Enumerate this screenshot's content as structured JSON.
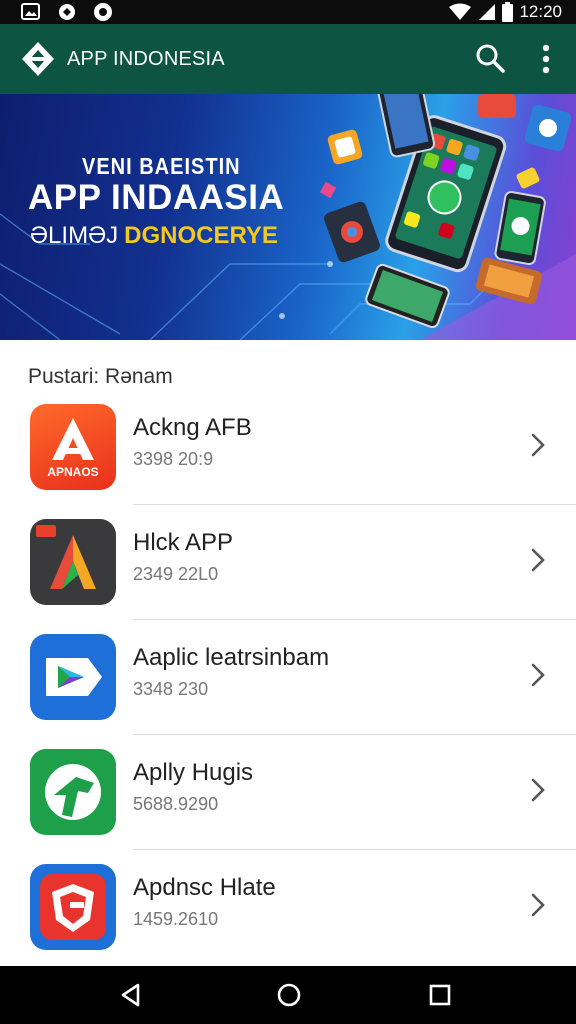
{
  "status_bar": {
    "time": "12:20",
    "icons": [
      "image-notification-icon",
      "app-notification-icon",
      "sync-notification-icon",
      "wifi-icon",
      "signal-icon",
      "battery-icon"
    ]
  },
  "app_bar": {
    "title": "APP INDONESIA",
    "logo_icon": "diamond-logo-icon",
    "actions": [
      "search-icon",
      "more-vert-icon"
    ],
    "color": "#0e5443"
  },
  "banner": {
    "line1": "VENI BAEISTIN",
    "line2": "APP INDAASIA",
    "line3_a": "ƏLIMƏJ",
    "line3_b": "DGNOCERYE",
    "highlight_color": "#f4c81c"
  },
  "section": {
    "title": "Pustari: Rənam"
  },
  "apps": [
    {
      "name": "Ackng AFB",
      "meta": "3398 20:9",
      "icon": "letter-a-icon",
      "icon_text": "APNAOS"
    },
    {
      "name": "Hlck APP",
      "meta": "2349 22L0",
      "icon": "multicolor-a-icon"
    },
    {
      "name": "Aaplic leatrsinbam",
      "meta": "3348 230",
      "icon": "play-arrow-icon"
    },
    {
      "name": "Aplly Hugis",
      "meta": "5688.9290",
      "icon": "green-arrow-icon"
    },
    {
      "name": "Apdnsc Hlate",
      "meta": "1459.2610",
      "icon": "red-shield-icon"
    }
  ],
  "nav_bar": {
    "buttons": [
      "back-icon",
      "home-icon",
      "recents-icon"
    ]
  }
}
